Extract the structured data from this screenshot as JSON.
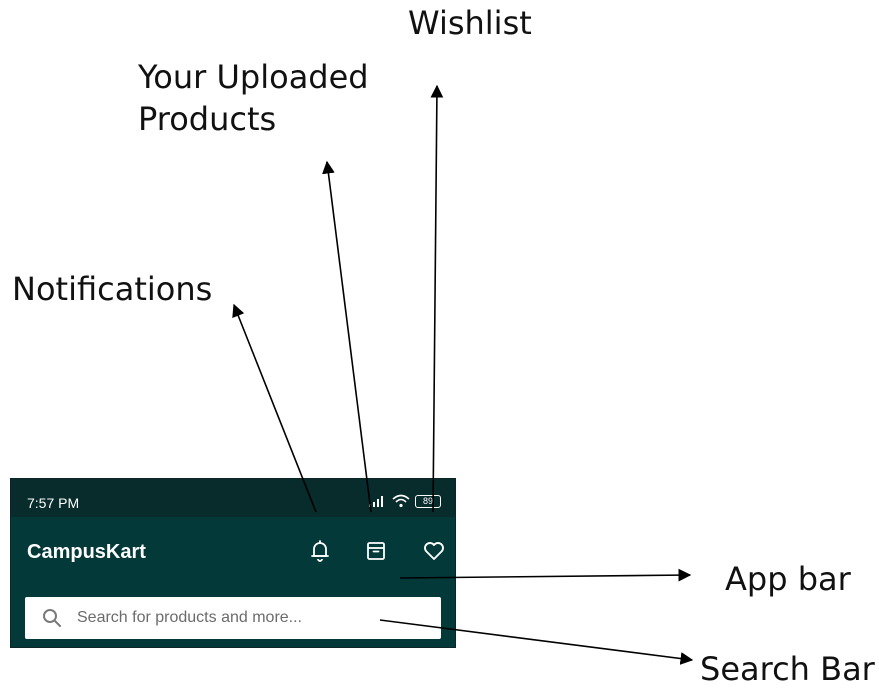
{
  "annotations": {
    "wishlist": "Wishlist",
    "uploaded_line1": "Your Uploaded",
    "uploaded_line2": "Products",
    "notifications": "Notifications",
    "app_bar": "App bar",
    "search_bar": "Search Bar"
  },
  "status_bar": {
    "time": "7:57 PM",
    "battery": "89",
    "icons": [
      "signal-icon",
      "wifi-icon",
      "battery-icon"
    ]
  },
  "app_bar": {
    "title": "CampusKart",
    "actions": [
      "bell-icon",
      "archive-icon",
      "heart-icon"
    ],
    "background": "#04393a"
  },
  "search": {
    "placeholder": "Search for products and more..."
  }
}
